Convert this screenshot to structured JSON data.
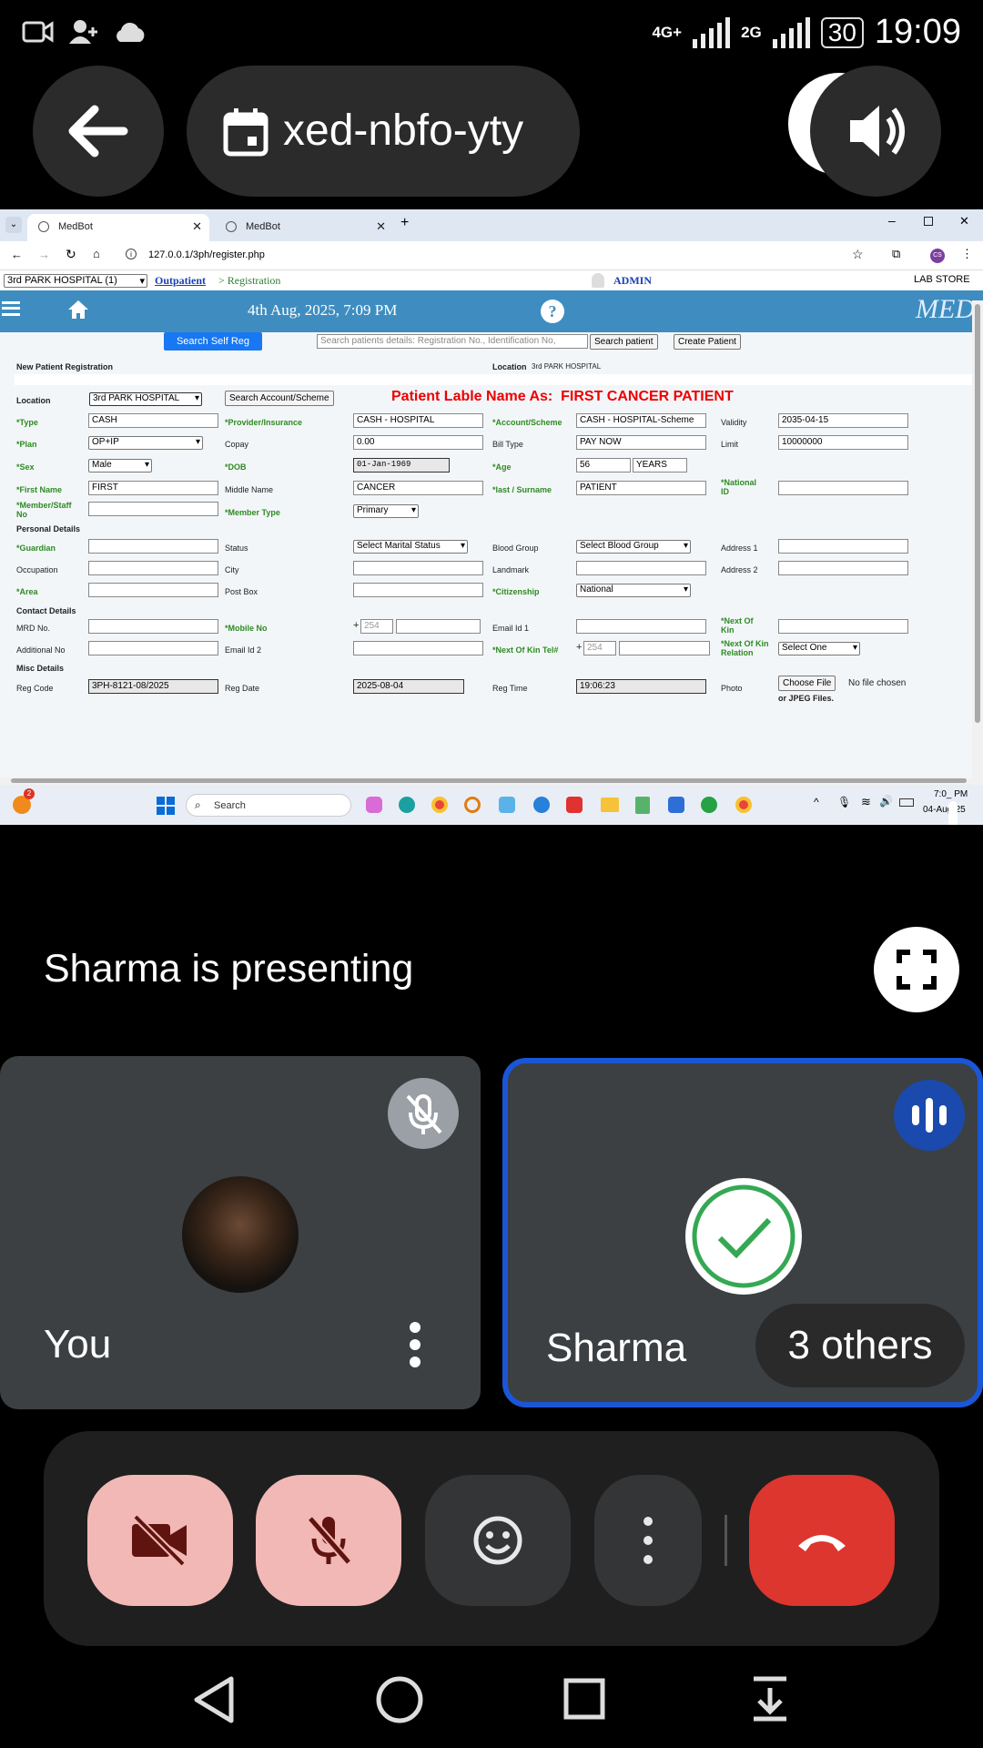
{
  "status_bar": {
    "network1": "4G+",
    "network2": "2G",
    "battery": "30",
    "time": "19:09"
  },
  "call": {
    "meeting_code": "xed-nbfo-yty",
    "presenting_text": "Sharma is presenting"
  },
  "browser": {
    "tabs": [
      {
        "label": "MedBot"
      },
      {
        "label": "MedBot"
      }
    ],
    "url": "127.0.0.1/3ph/register.php",
    "profile": "CS"
  },
  "app": {
    "hospital_select": "3rd PARK HOSPITAL (1)",
    "breadcrumb_link": "Outpatient",
    "breadcrumb_rest": "> Registration",
    "user": "ADMIN",
    "lab_store": "LAB STORE",
    "datetime": "4th Aug, 2025, 7:09 PM",
    "logo": "MED"
  },
  "form": {
    "search_self_reg": "Search Self Reg",
    "search_placeholder": "Search patients details: Registration No., Identification No,",
    "search_patient": "Search patient",
    "create_patient": "Create Patient",
    "section_title": "New Patient Registration",
    "location_header_label": "Location",
    "location_header_value": "3rd PARK HOSPITAL",
    "location_label": "Location",
    "location_value": "3rd PARK HOSPITAL",
    "search_account": "Search Account/Scheme",
    "patient_label": "Patient Lable Name As:  FIRST CANCER PATIENT",
    "type_label": "*Type",
    "type_value": "CASH",
    "provider_label": "*Provider/Insurance",
    "provider_value": "CASH - HOSPITAL",
    "account_label": "*Account/Scheme",
    "account_value": "CASH - HOSPITAL-Scheme",
    "validity_label": "Validity",
    "validity_value": "2035-04-15",
    "plan_label": "*Plan",
    "plan_value": "OP+IP",
    "copay_label": "Copay",
    "copay_value": "0.00",
    "billtype_label": "Bill Type",
    "billtype_value": "PAY NOW",
    "limit_label": "Limit",
    "limit_value": "10000000",
    "sex_label": "*Sex",
    "sex_value": "Male",
    "dob_label": "*DOB",
    "dob_value": "01-Jan-1969",
    "age_label": "*Age",
    "age_value": "56",
    "age_unit": "YEARS",
    "firstname_label": "*First Name",
    "firstname_value": "FIRST",
    "middlename_label": "Middle Name",
    "middlename_value": "CANCER",
    "lastname_label": "*last / Surname",
    "lastname_value": "PATIENT",
    "national_id_label": "*National ID",
    "member_label": "*Member/Staff No",
    "membertype_label": "*Member Type",
    "membertype_value": "Primary",
    "personal_details": "Personal Details",
    "guardian_label": "*Guardian",
    "status_label": "Status",
    "status_value": "Select Marital Status",
    "bloodgroup_label": "Blood Group",
    "bloodgroup_value": "Select Blood Group",
    "address1_label": "Address 1",
    "occupation_label": "Occupation",
    "city_label": "City",
    "landmark_label": "Landmark",
    "address2_label": "Address 2",
    "area_label": "*Area",
    "postbox_label": "Post Box",
    "citizenship_label": "*Citizenship",
    "citizenship_value": "National",
    "contact_details": "Contact Details",
    "mrd_label": "MRD No.",
    "mobile_label": "*Mobile No",
    "mobile_prefix": "254",
    "email1_label": "Email Id 1",
    "nok_label": "*Next Of Kin",
    "additional_label": "Additional No",
    "email2_label": "Email Id 2",
    "nok_tel_label": "*Next Of Kin Tel#",
    "nok_tel_prefix": "254",
    "nok_rel_label": "*Next Of Kin Relation",
    "nok_rel_value": "Select One",
    "misc_details": "Misc Details",
    "regcode_label": "Reg Code",
    "regcode_value": "3PH-8121-08/2025",
    "regdate_label": "Reg Date",
    "regdate_value": "2025-08-04",
    "regtime_label": "Reg Time",
    "regtime_value": "19:06:23",
    "photo_label": "Photo",
    "choose_file": "Choose File",
    "no_file": "No file chosen",
    "jpeg_note": "or JPEG Files."
  },
  "taskbar": {
    "search": "Search",
    "time": "7:0_ PM",
    "date": "04-Aug-25",
    "badge": "2"
  },
  "tiles": {
    "you": "You",
    "sharma": "Sharma",
    "others": "3 others"
  }
}
